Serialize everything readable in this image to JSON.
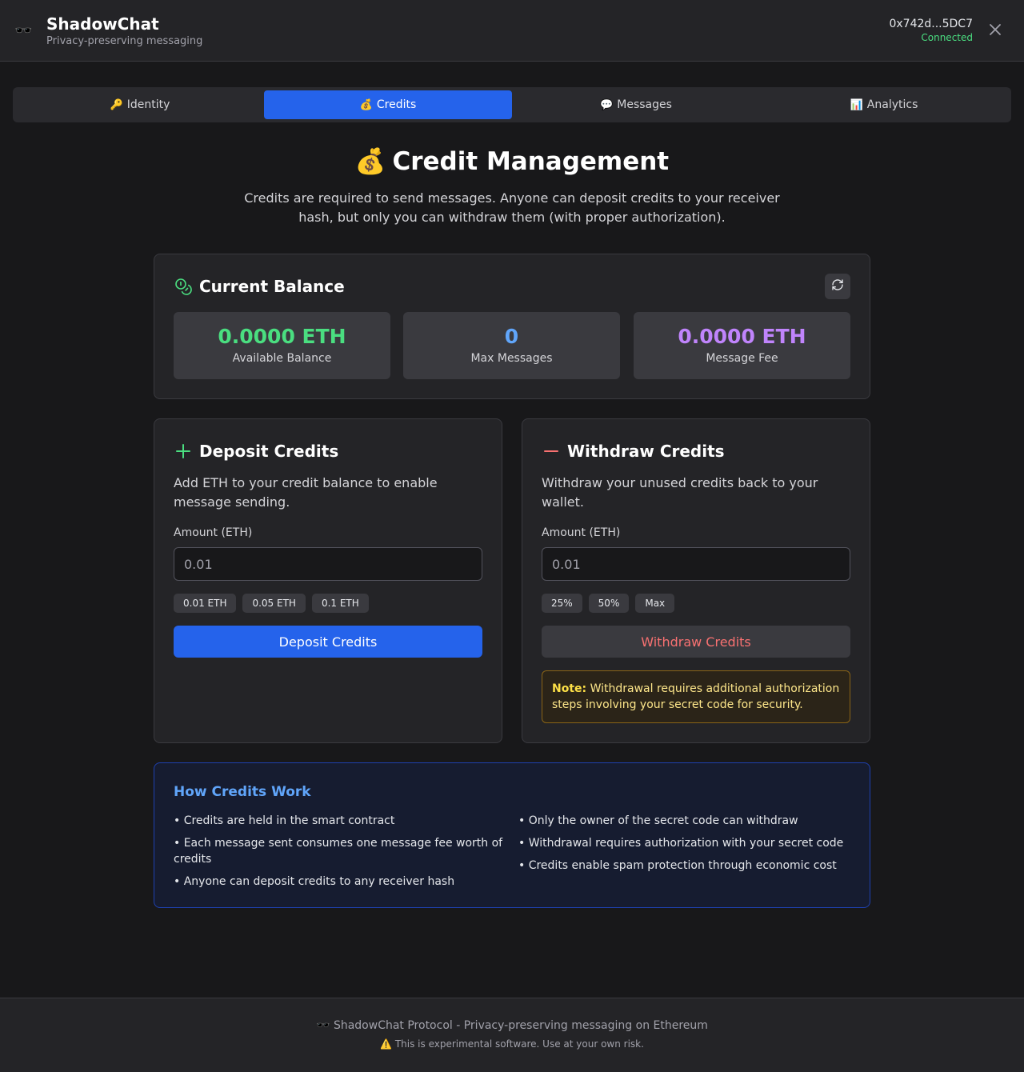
{
  "header": {
    "logo_icon": "🕶️",
    "app_name": "ShadowChat",
    "tagline": "Privacy-preserving messaging",
    "wallet_address": "0x742d...5DC7",
    "wallet_status": "Connected"
  },
  "tabs": [
    {
      "icon": "🔑",
      "label": "Identity",
      "active": false
    },
    {
      "icon": "💰",
      "label": "Credits",
      "active": true
    },
    {
      "icon": "💬",
      "label": "Messages",
      "active": false
    },
    {
      "icon": "📊",
      "label": "Analytics",
      "active": false
    }
  ],
  "page": {
    "title_icon": "💰",
    "title": "Credit Management",
    "description": "Credits are required to send messages. Anyone can deposit credits to your receiver hash, but only you can withdraw them (with proper authorization)."
  },
  "balance": {
    "title": "Current Balance",
    "stats": [
      {
        "value": "0.0000 ETH",
        "label": "Available Balance",
        "color": "#4ade80"
      },
      {
        "value": "0",
        "label": "Max Messages",
        "color": "#60a5fa"
      },
      {
        "value": "0.0000 ETH",
        "label": "Message Fee",
        "color": "#c084fc"
      }
    ]
  },
  "deposit": {
    "icon": "plus-icon",
    "title": "Deposit Credits",
    "description": "Add ETH to your credit balance to enable message sending.",
    "amount_label": "Amount (ETH)",
    "amount_placeholder": "0.01",
    "presets": [
      "0.01 ETH",
      "0.05 ETH",
      "0.1 ETH"
    ],
    "button_label": "Deposit Credits"
  },
  "withdraw": {
    "icon": "minus-icon",
    "title": "Withdraw Credits",
    "description": "Withdraw your unused credits back to your wallet.",
    "amount_label": "Amount (ETH)",
    "amount_placeholder": "0.01",
    "presets": [
      "25%",
      "50%",
      "Max"
    ],
    "button_label": "Withdraw Credits",
    "note_label": "Note:",
    "note_text": "Withdrawal requires additional authorization steps involving your secret code for security."
  },
  "info": {
    "title": "How Credits Work",
    "left_items": [
      "• Credits are held in the smart contract",
      "• Each message sent consumes one message fee worth of credits",
      "• Anyone can deposit credits to any receiver hash"
    ],
    "right_items": [
      "• Only the owner of the secret code can withdraw",
      "• Withdrawal requires authorization with your secret code",
      "• Credits enable spam protection through economic cost"
    ]
  },
  "footer": {
    "line1_icon": "🕶️",
    "line1": "ShadowChat Protocol - Privacy-preserving messaging on Ethereum",
    "line2_icon": "⚠️",
    "line2": "This is experimental software. Use at your own risk."
  }
}
